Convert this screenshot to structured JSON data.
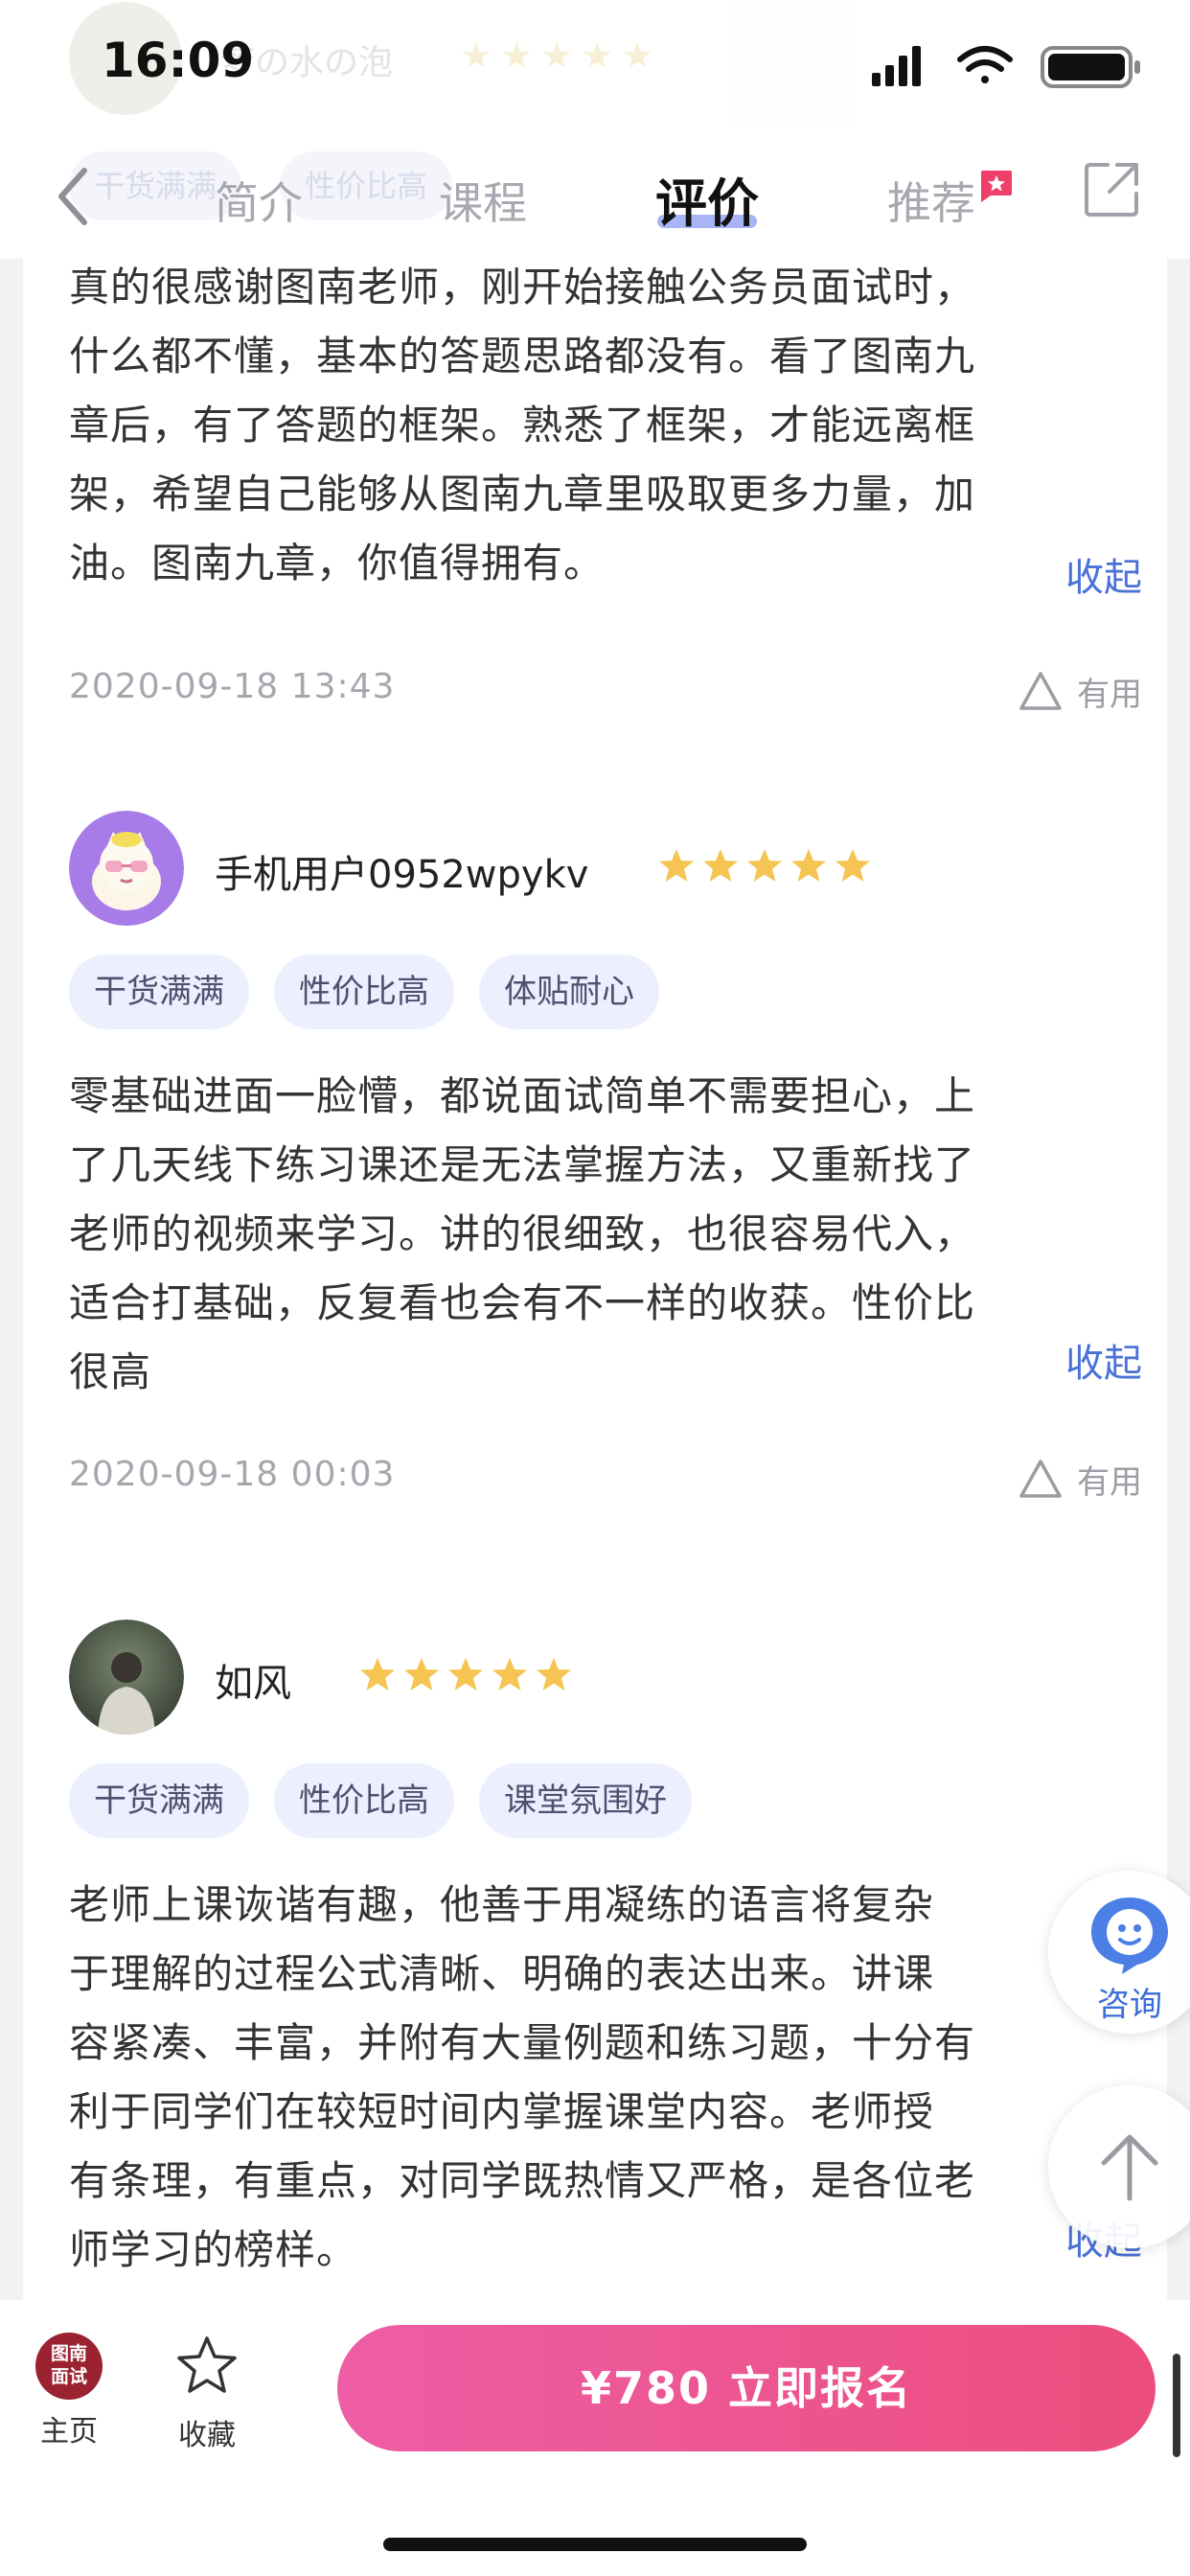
{
  "status_bar": {
    "time": "16:09"
  },
  "ghost_header": {
    "username": "梦の水の泡",
    "tags": [
      "干货满满",
      "性价比高"
    ]
  },
  "nav_tabs": {
    "items": [
      {
        "label": "简介"
      },
      {
        "label": "课程"
      },
      {
        "label": "评价"
      },
      {
        "label": "推荐"
      }
    ],
    "active": "评价"
  },
  "reviews": [
    {
      "text": "真的很感谢图南老师，刚开始接触公务员面试时，\n什么都不懂，基本的答题思路都没有。看了图南九\n章后，有了答题的框架。熟悉了框架，才能远离框\n架，希望自己能够从图南九章里吸取更多力量，加\n油。图南九章，你值得拥有。",
      "collapse_label": "收起",
      "date": "2020-09-18 13:43",
      "useful_label": "有用"
    },
    {
      "username": "手机用户0952wpykv",
      "rating": 5,
      "tags": [
        "干货满满",
        "性价比高",
        "体贴耐心"
      ],
      "text": "零基础进面一脸懵，都说面试简单不需要担心，上\n了几天线下练习课还是无法掌握方法，又重新找了\n老师的视频来学习。讲的很细致，也很容易代入，\n适合打基础，反复看也会有不一样的收获。性价比\n很高",
      "collapse_label": "收起",
      "date": "2020-09-18 00:03",
      "useful_label": "有用"
    },
    {
      "username": "如风",
      "rating": 5,
      "tags": [
        "干货满满",
        "性价比高",
        "课堂氛围好"
      ],
      "text": "老师上课诙谐有趣，他善于用凝练的语言将复杂\n于理解的过程公式清晰、明确的表达出来。讲课\n容紧凑、丰富，并附有大量例题和练习题，十分有\n利于同学们在较短时间内掌握课堂内容。老师授\n有条理，有重点，对同学既热情又严格，是各位老\n师学习的榜样。",
      "collapse_label": "收起"
    }
  ],
  "floating": {
    "consult_label": "咨询"
  },
  "bottom_bar": {
    "home_logo_line1": "图南",
    "home_logo_line2": "面试",
    "home_label": "主页",
    "favorite_label": "收藏",
    "cta_label": "¥780  立即报名"
  },
  "colors": {
    "accent_blue": "#4a72d6",
    "star_gold": "#f5c452",
    "cta_gradient_start": "#ee5da5",
    "cta_gradient_end": "#eb4e7d",
    "tag_bg": "#eceffd",
    "badge_red": "#ee3f68"
  },
  "icons": {
    "back": "chevron-left-icon",
    "share": "share-icon",
    "recommend_badge": "star-badge-icon",
    "useful": "triangle-thumb-icon",
    "star": "star-icon",
    "consult": "chat-bot-icon",
    "back_to_top": "arrow-up-icon",
    "favorite": "star-outline-icon"
  }
}
